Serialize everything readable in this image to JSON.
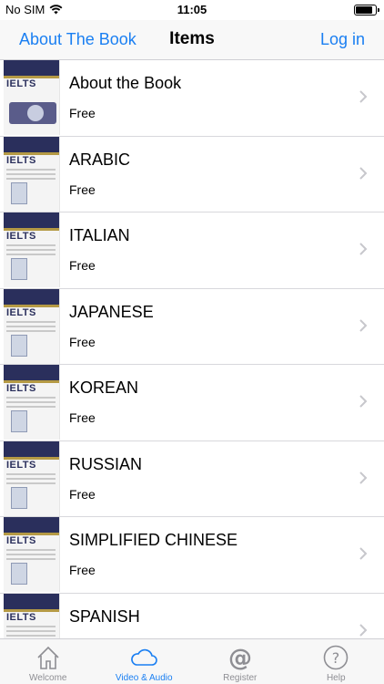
{
  "status": {
    "carrier": "No SIM",
    "time": "11:05",
    "battery_level": 0.85
  },
  "nav": {
    "left": "About The Book",
    "title": "Items",
    "right": "Log in"
  },
  "items": [
    {
      "title": "About the Book",
      "subtitle": "Free",
      "thumb": "cd"
    },
    {
      "title": "ARABIC",
      "subtitle": "Free",
      "thumb": "book"
    },
    {
      "title": "ITALIAN",
      "subtitle": "Free",
      "thumb": "book"
    },
    {
      "title": "JAPANESE",
      "subtitle": "Free",
      "thumb": "book"
    },
    {
      "title": "KOREAN",
      "subtitle": "Free",
      "thumb": "book"
    },
    {
      "title": "RUSSIAN",
      "subtitle": "Free",
      "thumb": "book"
    },
    {
      "title": "SIMPLIFIED CHINESE",
      "subtitle": "Free",
      "thumb": "book"
    },
    {
      "title": "SPANISH",
      "subtitle": "",
      "thumb": "book"
    }
  ],
  "thumb_label": "IELTS",
  "tabs": [
    {
      "label": "Welcome",
      "icon": "house-icon",
      "active": false
    },
    {
      "label": "Video & Audio",
      "icon": "cloud-icon",
      "active": true
    },
    {
      "label": "Register",
      "icon": "at-icon",
      "active": false
    },
    {
      "label": "Help",
      "icon": "question-icon",
      "active": false
    }
  ],
  "colors": {
    "accent": "#1a7ff2",
    "inactive": "#8e8e93",
    "book_cover": "#2a2f5c",
    "gold": "#b59a45"
  }
}
